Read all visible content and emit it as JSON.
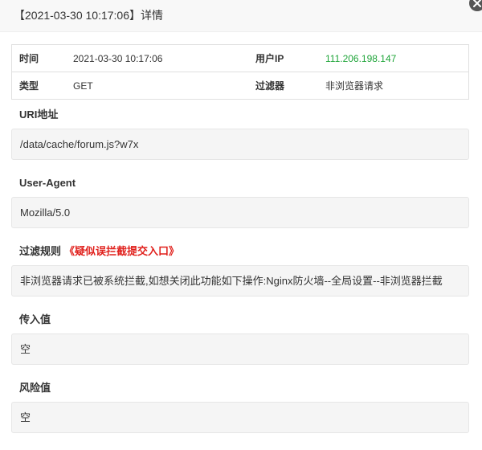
{
  "dialog": {
    "title": "【2021-03-30 10:17:06】详情"
  },
  "info": {
    "time_label": "时间",
    "time_value": "2021-03-30 10:17:06",
    "ip_label": "用户IP",
    "ip_value": "111.206.198.147",
    "type_label": "类型",
    "type_value": "GET",
    "filter_label": "过滤器",
    "filter_value": "非浏览器请求"
  },
  "uri": {
    "label": "URI地址",
    "value": "/data/cache/forum.js?w7x"
  },
  "user_agent": {
    "label": "User-Agent",
    "value": "Mozilla/5.0"
  },
  "filter_rule": {
    "label": "过滤规则",
    "link": "《疑似误拦截提交入口》",
    "value": "非浏览器请求已被系统拦截,如想关闭此功能如下操作:Nginx防火墙--全局设置--非浏览器拦截"
  },
  "input_value": {
    "label": "传入值",
    "value": "空"
  },
  "risk_value": {
    "label": "风险值",
    "value": "空"
  },
  "colors": {
    "ip_green": "#20a53a",
    "link_red": "#e0201c",
    "titlebar_bg": "#f8f8f8",
    "box_bg": "#f5f5f5"
  },
  "icons": {
    "close": "close-icon"
  }
}
